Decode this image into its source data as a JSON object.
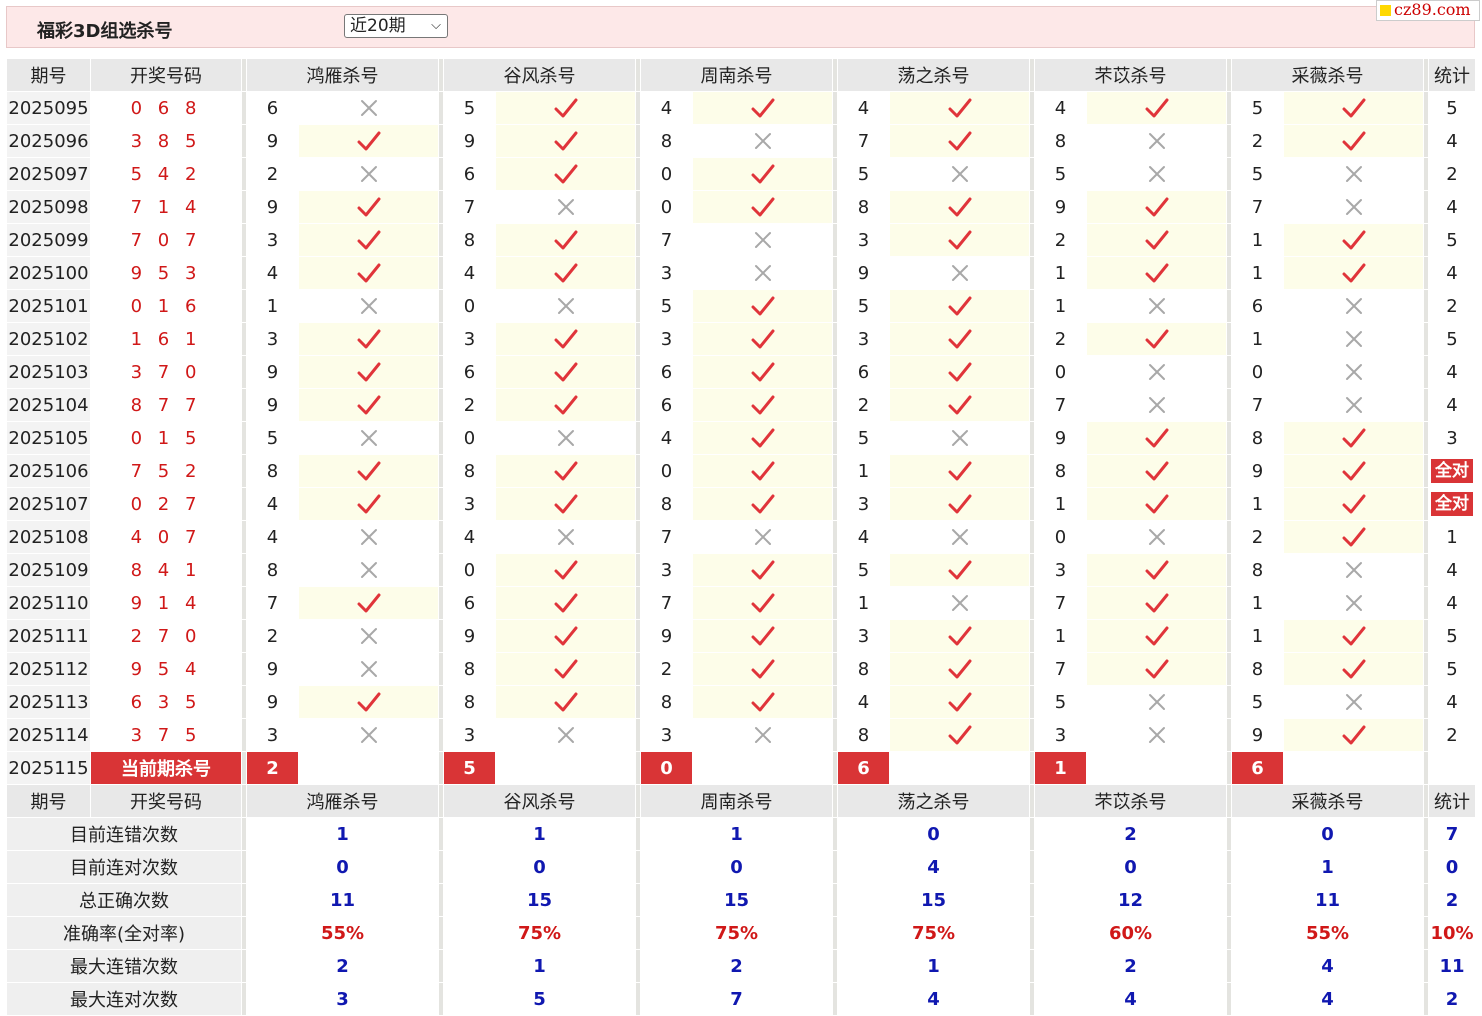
{
  "header": {
    "title": "福彩3D组选杀号",
    "period_select": "近20期",
    "logo_text": "cz89.com"
  },
  "columns": {
    "period": "期号",
    "draw": "开奖号码",
    "methods": [
      "鸿雁杀号",
      "谷风杀号",
      "周南杀号",
      "荡之杀号",
      "芣苡杀号",
      "采薇杀号"
    ],
    "stat": "统计"
  },
  "rows": [
    {
      "period": "2025095",
      "draw": "0 6 8",
      "picks": [
        6,
        5,
        4,
        4,
        4,
        5
      ],
      "marks": [
        0,
        1,
        1,
        1,
        1,
        1
      ],
      "stat": "5"
    },
    {
      "period": "2025096",
      "draw": "3 8 5",
      "picks": [
        9,
        9,
        8,
        7,
        8,
        2
      ],
      "marks": [
        1,
        1,
        0,
        1,
        0,
        1
      ],
      "stat": "4"
    },
    {
      "period": "2025097",
      "draw": "5 4 2",
      "picks": [
        2,
        6,
        0,
        5,
        5,
        5
      ],
      "marks": [
        0,
        1,
        1,
        0,
        0,
        0
      ],
      "stat": "2"
    },
    {
      "period": "2025098",
      "draw": "7 1 4",
      "picks": [
        9,
        7,
        0,
        8,
        9,
        7
      ],
      "marks": [
        1,
        0,
        1,
        1,
        1,
        0
      ],
      "stat": "4"
    },
    {
      "period": "2025099",
      "draw": "7 0 7",
      "picks": [
        3,
        8,
        7,
        3,
        2,
        1
      ],
      "marks": [
        1,
        1,
        0,
        1,
        1,
        1
      ],
      "stat": "5"
    },
    {
      "period": "2025100",
      "draw": "9 5 3",
      "picks": [
        4,
        4,
        3,
        9,
        1,
        1
      ],
      "marks": [
        1,
        1,
        0,
        0,
        1,
        1
      ],
      "stat": "4"
    },
    {
      "period": "2025101",
      "draw": "0 1 6",
      "picks": [
        1,
        0,
        5,
        5,
        1,
        6
      ],
      "marks": [
        0,
        0,
        1,
        1,
        0,
        0
      ],
      "stat": "2"
    },
    {
      "period": "2025102",
      "draw": "1 6 1",
      "picks": [
        3,
        3,
        3,
        3,
        2,
        1
      ],
      "marks": [
        1,
        1,
        1,
        1,
        1,
        0
      ],
      "stat": "5"
    },
    {
      "period": "2025103",
      "draw": "3 7 0",
      "picks": [
        9,
        6,
        6,
        6,
        0,
        0
      ],
      "marks": [
        1,
        1,
        1,
        1,
        0,
        0
      ],
      "stat": "4"
    },
    {
      "period": "2025104",
      "draw": "8 7 7",
      "picks": [
        9,
        2,
        6,
        2,
        7,
        7
      ],
      "marks": [
        1,
        1,
        1,
        1,
        0,
        0
      ],
      "stat": "4"
    },
    {
      "period": "2025105",
      "draw": "0 1 5",
      "picks": [
        5,
        0,
        4,
        5,
        9,
        8
      ],
      "marks": [
        0,
        0,
        1,
        0,
        1,
        1
      ],
      "stat": "3"
    },
    {
      "period": "2025106",
      "draw": "7 5 2",
      "picks": [
        8,
        8,
        0,
        1,
        8,
        9
      ],
      "marks": [
        1,
        1,
        1,
        1,
        1,
        1
      ],
      "stat": "全对"
    },
    {
      "period": "2025107",
      "draw": "0 2 7",
      "picks": [
        4,
        3,
        8,
        3,
        1,
        1
      ],
      "marks": [
        1,
        1,
        1,
        1,
        1,
        1
      ],
      "stat": "全对"
    },
    {
      "period": "2025108",
      "draw": "4 0 7",
      "picks": [
        4,
        4,
        7,
        4,
        0,
        2
      ],
      "marks": [
        0,
        0,
        0,
        0,
        0,
        1
      ],
      "stat": "1"
    },
    {
      "period": "2025109",
      "draw": "8 4 1",
      "picks": [
        8,
        0,
        3,
        5,
        3,
        8
      ],
      "marks": [
        0,
        1,
        1,
        1,
        1,
        0
      ],
      "stat": "4"
    },
    {
      "period": "2025110",
      "draw": "9 1 4",
      "picks": [
        7,
        6,
        7,
        1,
        7,
        1
      ],
      "marks": [
        1,
        1,
        1,
        0,
        1,
        0
      ],
      "stat": "4"
    },
    {
      "period": "2025111",
      "draw": "2 7 0",
      "picks": [
        2,
        9,
        9,
        3,
        1,
        1
      ],
      "marks": [
        0,
        1,
        1,
        1,
        1,
        1
      ],
      "stat": "5"
    },
    {
      "period": "2025112",
      "draw": "9 5 4",
      "picks": [
        9,
        8,
        2,
        8,
        7,
        8
      ],
      "marks": [
        0,
        1,
        1,
        1,
        1,
        1
      ],
      "stat": "5"
    },
    {
      "period": "2025113",
      "draw": "6 3 5",
      "picks": [
        9,
        8,
        8,
        4,
        5,
        5
      ],
      "marks": [
        1,
        1,
        1,
        1,
        0,
        0
      ],
      "stat": "4"
    },
    {
      "period": "2025114",
      "draw": "3 7 5",
      "picks": [
        3,
        3,
        3,
        8,
        3,
        9
      ],
      "marks": [
        0,
        0,
        0,
        1,
        0,
        1
      ],
      "stat": "2"
    }
  ],
  "current": {
    "period": "2025115",
    "label": "当前期杀号",
    "picks": [
      "2",
      "5",
      "0",
      "6",
      "1",
      "6"
    ]
  },
  "summary": [
    {
      "label": "目前连错次数",
      "values": [
        "1",
        "1",
        "1",
        "0",
        "2",
        "0"
      ],
      "stat": "7",
      "color": "blue"
    },
    {
      "label": "目前连对次数",
      "values": [
        "0",
        "0",
        "0",
        "4",
        "0",
        "1"
      ],
      "stat": "0",
      "color": "blue"
    },
    {
      "label": "总正确次数",
      "values": [
        "11",
        "15",
        "15",
        "15",
        "12",
        "11"
      ],
      "stat": "2",
      "color": "blue"
    },
    {
      "label": "准确率(全对率)",
      "values": [
        "55%",
        "75%",
        "75%",
        "75%",
        "60%",
        "55%"
      ],
      "stat": "10%",
      "color": "red"
    },
    {
      "label": "最大连错次数",
      "values": [
        "2",
        "1",
        "2",
        "1",
        "2",
        "4"
      ],
      "stat": "11",
      "color": "blue"
    },
    {
      "label": "最大连对次数",
      "values": [
        "3",
        "5",
        "7",
        "4",
        "4",
        "4"
      ],
      "stat": "2",
      "color": "blue"
    }
  ],
  "colors": {
    "check": "#e0343a",
    "cross": "#a8a8a8",
    "accent": "#d93436",
    "hit_bg": "#fdfde9"
  }
}
